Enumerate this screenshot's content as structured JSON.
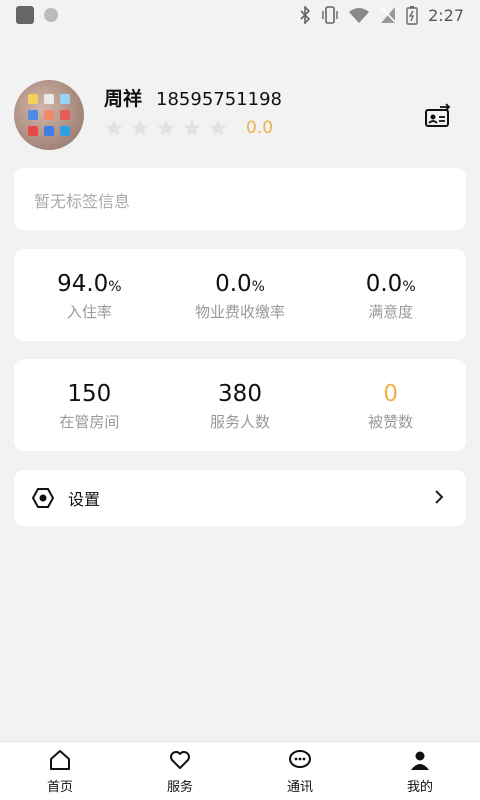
{
  "status_bar": {
    "time": "2:27"
  },
  "profile": {
    "name": "周祥",
    "phone": "18595751198",
    "rating": "0.0",
    "star_count": 5
  },
  "tags": {
    "placeholder": "暂无标签信息"
  },
  "stats_row_1": [
    {
      "value": "94.0",
      "unit": "%",
      "label": "入住率"
    },
    {
      "value": "0.0",
      "unit": "%",
      "label": "物业费收缴率"
    },
    {
      "value": "0.0",
      "unit": "%",
      "label": "满意度"
    }
  ],
  "stats_row_2": [
    {
      "value": "150",
      "label": "在管房间"
    },
    {
      "value": "380",
      "label": "服务人数"
    },
    {
      "value": "0",
      "label": "被赞数"
    }
  ],
  "settings": {
    "label": "设置"
  },
  "tabs": [
    {
      "label": "首页",
      "icon": "home-icon"
    },
    {
      "label": "服务",
      "icon": "heart-icon"
    },
    {
      "label": "通讯",
      "icon": "chat-icon"
    },
    {
      "label": "我的",
      "icon": "user-icon"
    }
  ],
  "colors": {
    "accent": "#f0b04a",
    "background": "#f2f2f2",
    "card": "#ffffff"
  }
}
